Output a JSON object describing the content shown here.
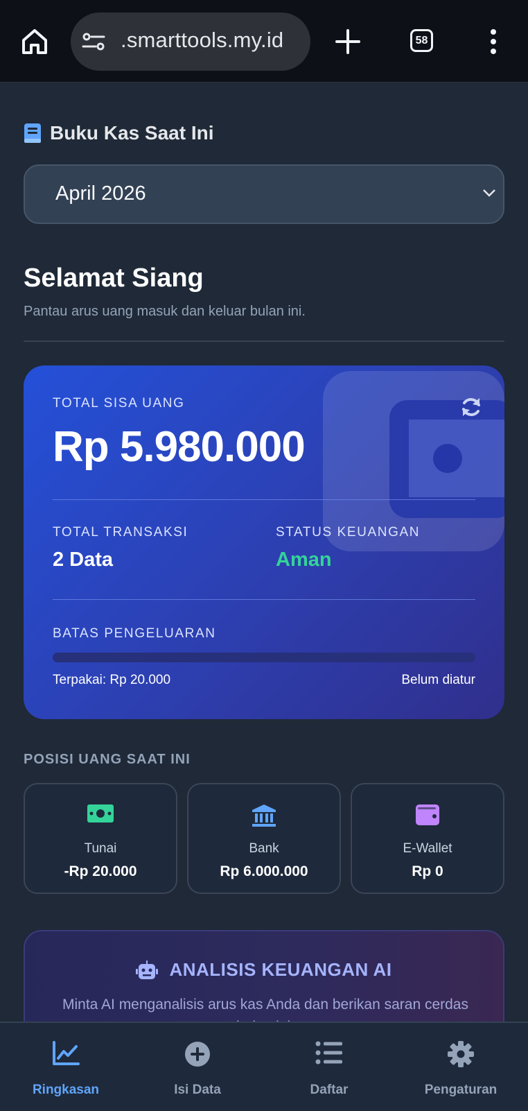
{
  "browser": {
    "url": ".smarttools.my.id",
    "tab_count": "58"
  },
  "cashbook": {
    "title": "Buku Kas Saat Ini",
    "selected_month": "April 2026"
  },
  "greeting": {
    "title": "Selamat Siang",
    "subtitle": "Pantau arus uang masuk dan keluar bulan ini."
  },
  "summary": {
    "total_label": "TOTAL SISA UANG",
    "total_value": "Rp 5.980.000",
    "transactions_label": "TOTAL TRANSAKSI",
    "transactions_value": "2 Data",
    "status_label": "STATUS KEUANGAN",
    "status_value": "Aman",
    "status_color": "#34d399",
    "limit_label": "BATAS PENGELUARAN",
    "limit_progress": 0,
    "used_text": "Terpakai: Rp 20.000",
    "limit_text": "Belum diatur"
  },
  "positions": {
    "title": "POSISI UANG SAAT INI",
    "items": [
      {
        "name": "Tunai",
        "amount": "-Rp 20.000",
        "icon": "money-bill-icon",
        "color": "#34d399"
      },
      {
        "name": "Bank",
        "amount": "Rp 6.000.000",
        "icon": "bank-icon",
        "color": "#60a5fa"
      },
      {
        "name": "E-Wallet",
        "amount": "Rp 0",
        "icon": "wallet-icon",
        "color": "#c084fc"
      }
    ]
  },
  "ai": {
    "title": "ANALISIS KEUANGAN AI",
    "description": "Minta AI menganalisis arus kas Anda dan berikan saran cerdas bulan ini."
  },
  "nav": {
    "items": [
      {
        "label": "Ringkasan",
        "icon": "chart-line-icon",
        "active": true
      },
      {
        "label": "Isi Data",
        "icon": "plus-circle-icon",
        "active": false
      },
      {
        "label": "Daftar",
        "icon": "list-icon",
        "active": false
      },
      {
        "label": "Pengaturan",
        "icon": "gear-icon",
        "active": false
      }
    ],
    "accent": "#60a5fa"
  }
}
